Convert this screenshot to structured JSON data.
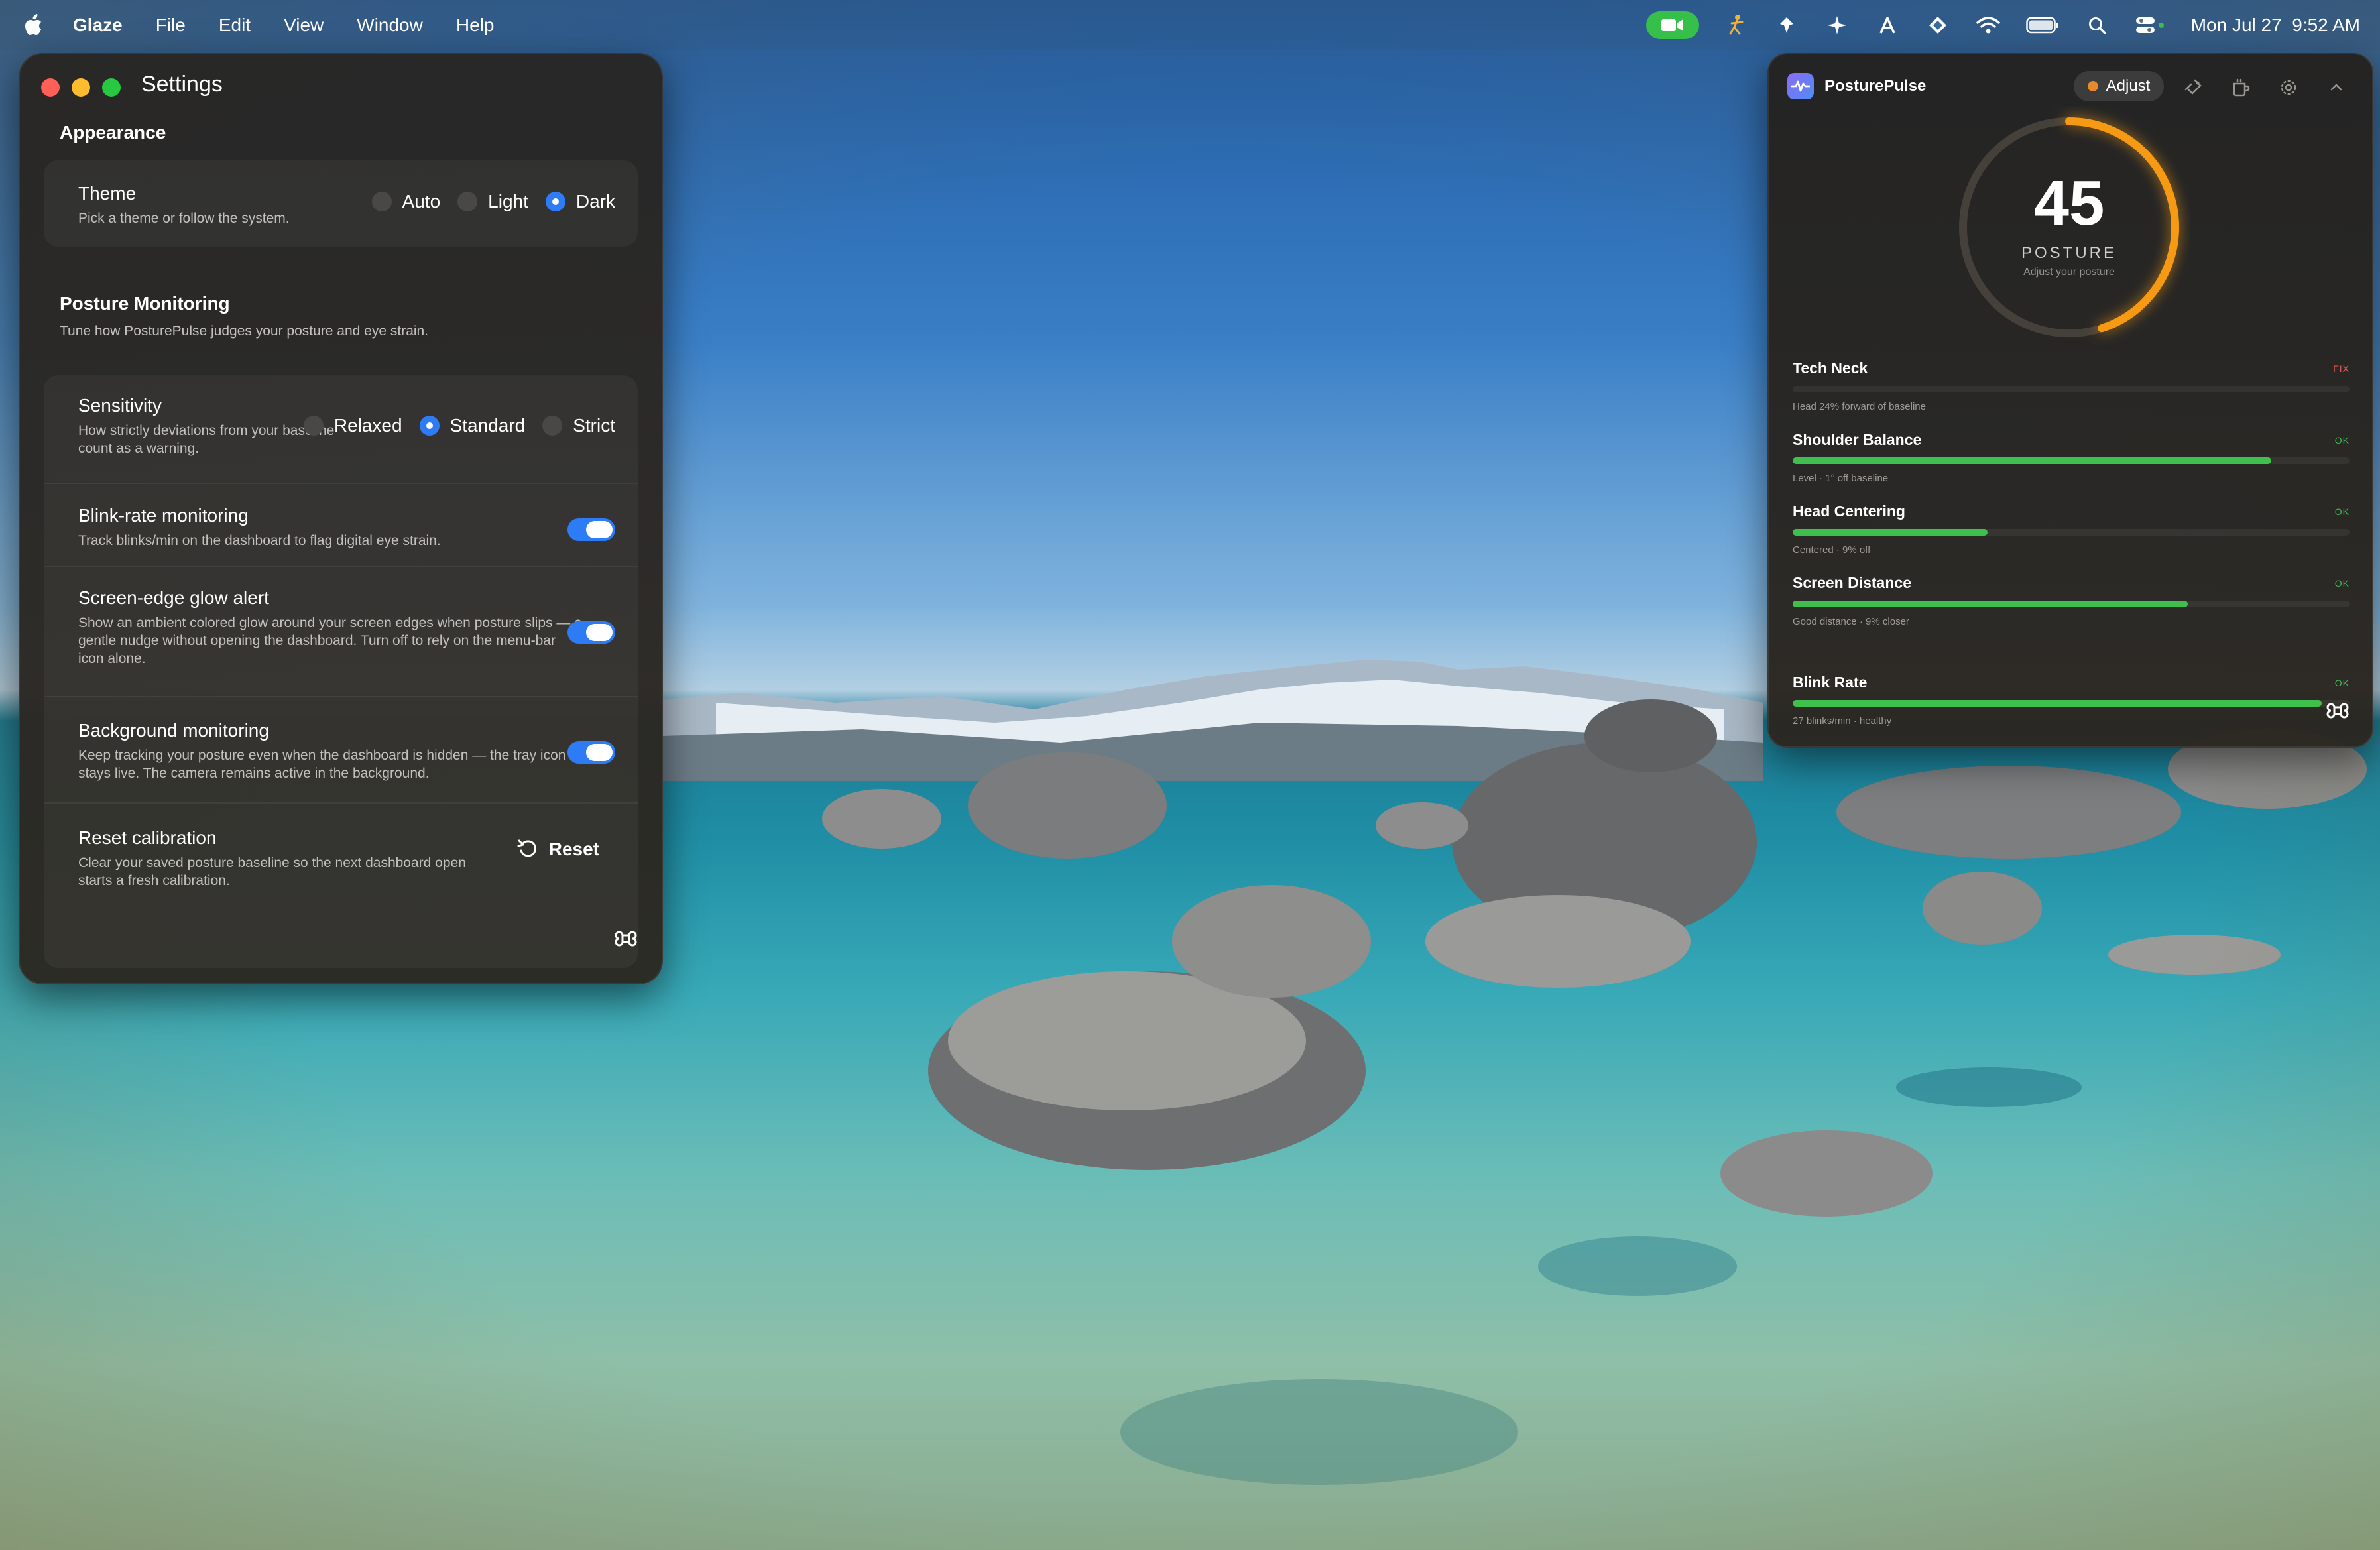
{
  "menubar": {
    "apple_icon": "apple-logo-icon",
    "app_name": "Glaze",
    "menus": [
      "File",
      "Edit",
      "View",
      "Window",
      "Help"
    ],
    "clock": "Mon Jul 27  9:52 AM"
  },
  "settings": {
    "title": "Settings",
    "appearance": {
      "heading": "Appearance",
      "theme": {
        "title": "Theme",
        "desc": "Pick a theme or follow the system.",
        "options": [
          "Auto",
          "Light",
          "Dark"
        ],
        "selected": "Dark"
      }
    },
    "posture": {
      "heading": "Posture Monitoring",
      "subheading": "Tune how PosturePulse judges your posture and eye strain.",
      "sensitivity": {
        "title": "Sensitivity",
        "desc": "How strictly deviations from your baseline count as a warning.",
        "options": [
          "Relaxed",
          "Standard",
          "Strict"
        ],
        "selected": "Standard"
      },
      "blink": {
        "title": "Blink-rate monitoring",
        "desc": "Track blinks/min on the dashboard to flag digital eye strain.",
        "enabled": true
      },
      "glow": {
        "title": "Screen-edge glow alert",
        "desc": "Show an ambient colored glow around your screen edges when posture slips — a gentle nudge without opening the dashboard. Turn off to rely on the menu-bar icon alone.",
        "enabled": true
      },
      "background": {
        "title": "Background monitoring",
        "desc": "Keep tracking your posture even when the dashboard is hidden — the tray icon stays live. The camera remains active in the background.",
        "enabled": true
      },
      "reset": {
        "title": "Reset calibration",
        "desc": "Clear your saved posture baseline so the next dashboard open starts a fresh calibration.",
        "button_label": "Reset"
      }
    }
  },
  "widget": {
    "app_name": "PosturePulse",
    "adjust_label": "Adjust",
    "gauge": {
      "value": "45",
      "label": "POSTURE",
      "sublabel": "Adjust your posture",
      "fraction": 0.45,
      "color": "#f59a12"
    },
    "metrics": [
      {
        "name": "Tech Neck",
        "status": "FIX",
        "detail": "Head 24% forward of baseline",
        "level": 0,
        "color": "#e25a4e"
      },
      {
        "name": "Shoulder Balance",
        "status": "OK",
        "detail": "Level · 1° off baseline",
        "level": 0.86,
        "color": "#3fc04e"
      },
      {
        "name": "Head Centering",
        "status": "OK",
        "detail": "Centered · 9% off",
        "level": 0.35,
        "color": "#3fc04e"
      },
      {
        "name": "Screen Distance",
        "status": "OK",
        "detail": "Good distance · 9% closer",
        "level": 0.71,
        "color": "#3fc04e"
      },
      {
        "name": "Blink Rate",
        "status": "OK",
        "detail": "27 blinks/min · healthy",
        "level": 0.95,
        "color": "#3fc04e"
      }
    ]
  }
}
